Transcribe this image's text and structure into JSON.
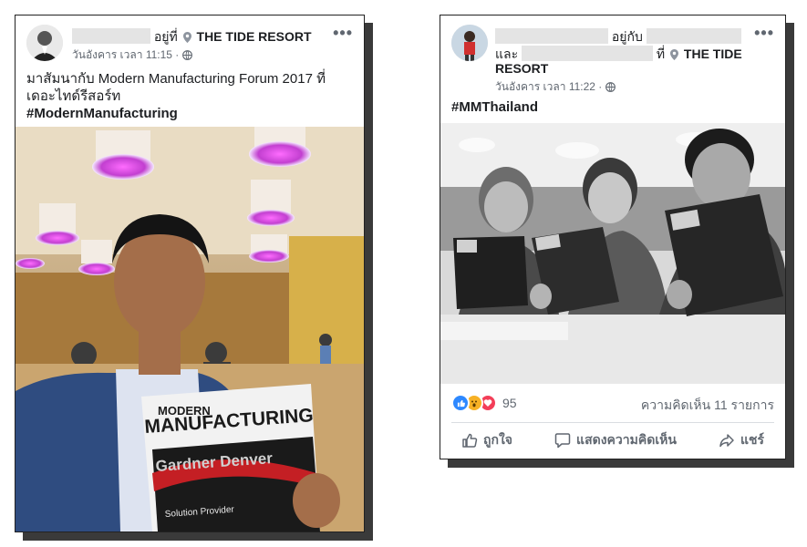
{
  "post_left": {
    "location_prefix": "อยู่ที่",
    "location": "THE TIDE RESORT",
    "timestamp": "วันอังคาร เวลา 11:15 ·",
    "caption": "มาสัมนากับ Modern Manufacturing Forum 2017 ที่เดอะไทด์รีสอร์ท",
    "hashtag": "#ModernManufacturing",
    "magazine": {
      "title_line1": "MODERN",
      "title_line2": "MANUFACTURING",
      "brand": "Gardner Denver",
      "tagline": "Solution Provider"
    }
  },
  "post_right": {
    "with_prefix": "อยู่กับ",
    "and_prefix": "และ",
    "location_prefix": "ที่",
    "location_line1": "THE TIDE",
    "location_line2": "RESORT",
    "timestamp": "วันอังคาร เวลา 11:22 ·",
    "hashtag": "#MMThailand",
    "reaction_count": "95",
    "comment_count": "ความคิดเห็น 11 รายการ",
    "actions": {
      "like": "ถูกใจ",
      "comment": "แสดงความคิดเห็น",
      "share": "แชร์"
    }
  },
  "icons": [
    "more-icon",
    "location-pin-icon",
    "globe-icon",
    "like-reaction-icon",
    "wow-reaction-icon",
    "love-reaction-icon",
    "thumbs-up-icon",
    "comment-bubble-icon",
    "share-arrow-icon"
  ],
  "colors": {
    "like_blue": "#2d88ff",
    "love_red": "#f33e58",
    "wow_yellow": "#f7b125",
    "meta_gray": "#606770"
  }
}
